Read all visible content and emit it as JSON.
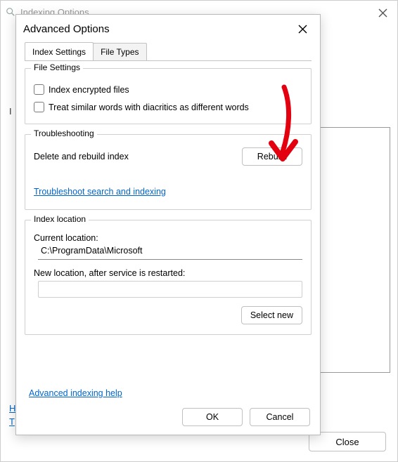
{
  "bg_window": {
    "title": "Indexing Options",
    "left_letter_ind": "I",
    "left_letter_h": "H",
    "left_letter_t": "T",
    "close_btn": "Close"
  },
  "dialog": {
    "title": "Advanced Options",
    "tabs": [
      "Index Settings",
      "File Types"
    ],
    "active_tab": 0,
    "file_settings": {
      "legend": "File Settings",
      "chk_encrypted": "Index encrypted files",
      "chk_diacritics": "Treat similar words with diacritics as different words"
    },
    "troubleshooting": {
      "legend": "Troubleshooting",
      "rebuild_label": "Delete and rebuild index",
      "rebuild_btn": "Rebuild",
      "ts_link": "Troubleshoot search and indexing"
    },
    "index_location": {
      "legend": "Index location",
      "current_label": "Current location:",
      "current_value": "C:\\ProgramData\\Microsoft",
      "new_label": "New location, after service is restarted:",
      "new_value": "",
      "select_new_btn": "Select new"
    },
    "adv_help_link": "Advanced indexing help",
    "ok_btn": "OK",
    "cancel_btn": "Cancel"
  }
}
